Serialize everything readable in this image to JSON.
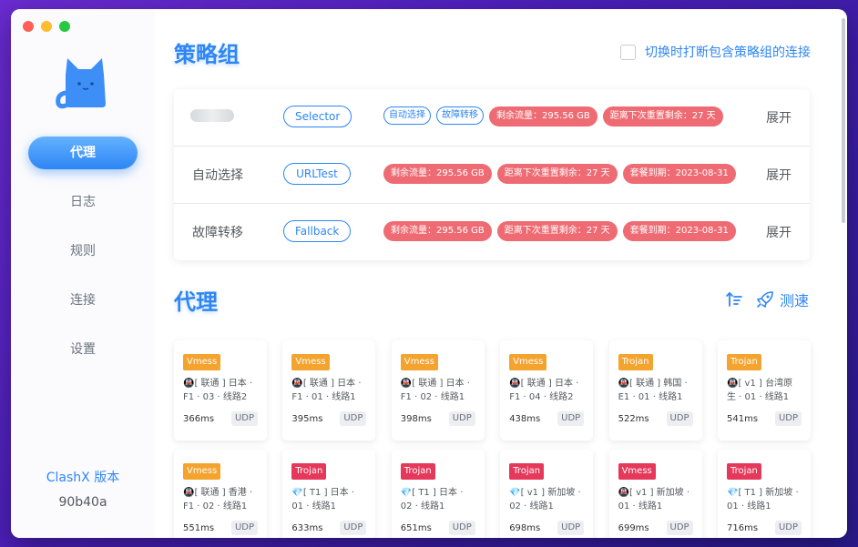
{
  "sidebar": {
    "nav": [
      {
        "label": "代理",
        "active": true
      },
      {
        "label": "日志",
        "active": false
      },
      {
        "label": "规则",
        "active": false
      },
      {
        "label": "连接",
        "active": false
      },
      {
        "label": "设置",
        "active": false
      }
    ],
    "version_label": "ClashX 版本",
    "version_value": "90b40a"
  },
  "policy_groups": {
    "title": "策略组",
    "disconnect_option": "切换时打断包含策略组的连接",
    "expand_label": "展开",
    "rows": [
      {
        "name": "",
        "type": "Selector",
        "outline_tags": [
          "自动选择",
          "故障转移"
        ],
        "red_tags": [
          "剩余流量：295.56 GB",
          "距离下次重置剩余：27 天"
        ]
      },
      {
        "name": "自动选择",
        "type": "URLTest",
        "outline_tags": [],
        "red_tags": [
          "剩余流量：295.56 GB",
          "距离下次重置剩余：27 天",
          "套餐到期：2023-08-31"
        ]
      },
      {
        "name": "故障转移",
        "type": "Fallback",
        "outline_tags": [],
        "red_tags": [
          "剩余流量：295.56 GB",
          "距离下次重置剩余：27 天",
          "套餐到期：2023-08-31"
        ]
      }
    ]
  },
  "proxies": {
    "title": "代理",
    "speed_test_label": "测速",
    "cards": [
      {
        "protocol": "Vmess",
        "color": "orange",
        "line1": "🚇[ 联通 ] 日本 ·",
        "line2": "F1 · 03 · 线路2",
        "delay": "366ms",
        "udp": "UDP"
      },
      {
        "protocol": "Vmess",
        "color": "orange",
        "line1": "🚇[ 联通 ] 日本 ·",
        "line2": "F1 · 01 · 线路1",
        "delay": "395ms",
        "udp": "UDP"
      },
      {
        "protocol": "Vmess",
        "color": "orange",
        "line1": "🚇[ 联通 ] 日本 ·",
        "line2": "F1 · 02 · 线路1",
        "delay": "398ms",
        "udp": "UDP"
      },
      {
        "protocol": "Vmess",
        "color": "orange",
        "line1": "🚇[ 联通 ] 日本 ·",
        "line2": "F1 · 04 · 线路2",
        "delay": "438ms",
        "udp": "UDP"
      },
      {
        "protocol": "Trojan",
        "color": "orange",
        "line1": "🚇[ 联通 ] 韩国 ·",
        "line2": "E1 · 01 · 线路1",
        "delay": "522ms",
        "udp": "UDP"
      },
      {
        "protocol": "Trojan",
        "color": "orange",
        "line1": "🚇[ v1 ] 台湾原",
        "line2": "生 · 01 · 线路1",
        "delay": "541ms",
        "udp": "UDP"
      },
      {
        "protocol": "Vmess",
        "color": "orange",
        "line1": "🚇[ 联通 ] 香港 ·",
        "line2": "F1 · 02 · 线路1",
        "delay": "551ms",
        "udp": "UDP"
      },
      {
        "protocol": "Trojan",
        "color": "red",
        "line1": "💎[ T1 ] 日本 ·",
        "line2": "01 · 线路1",
        "delay": "633ms",
        "udp": "UDP"
      },
      {
        "protocol": "Trojan",
        "color": "red",
        "line1": "💎[ T1 ] 日本 ·",
        "line2": "02 · 线路1",
        "delay": "651ms",
        "udp": "UDP"
      },
      {
        "protocol": "Trojan",
        "color": "red",
        "line1": "💎[ v1 ] 新加坡 ·",
        "line2": "02 · 线路1",
        "delay": "698ms",
        "udp": "UDP"
      },
      {
        "protocol": "Vmess",
        "color": "red",
        "line1": "🚇[ v1 ] 新加坡 ·",
        "line2": "01 · 线路1",
        "delay": "699ms",
        "udp": "UDP"
      },
      {
        "protocol": "Trojan",
        "color": "red",
        "line1": "💎[ T1 ] 新加坡 ·",
        "line2": "01 · 线路1",
        "delay": "716ms",
        "udp": "UDP"
      }
    ]
  },
  "colors": {
    "accent": "#2e86f5",
    "tag_red": "#ef6b73",
    "proto_orange": "#f4a32e",
    "proto_red": "#e5385a"
  }
}
